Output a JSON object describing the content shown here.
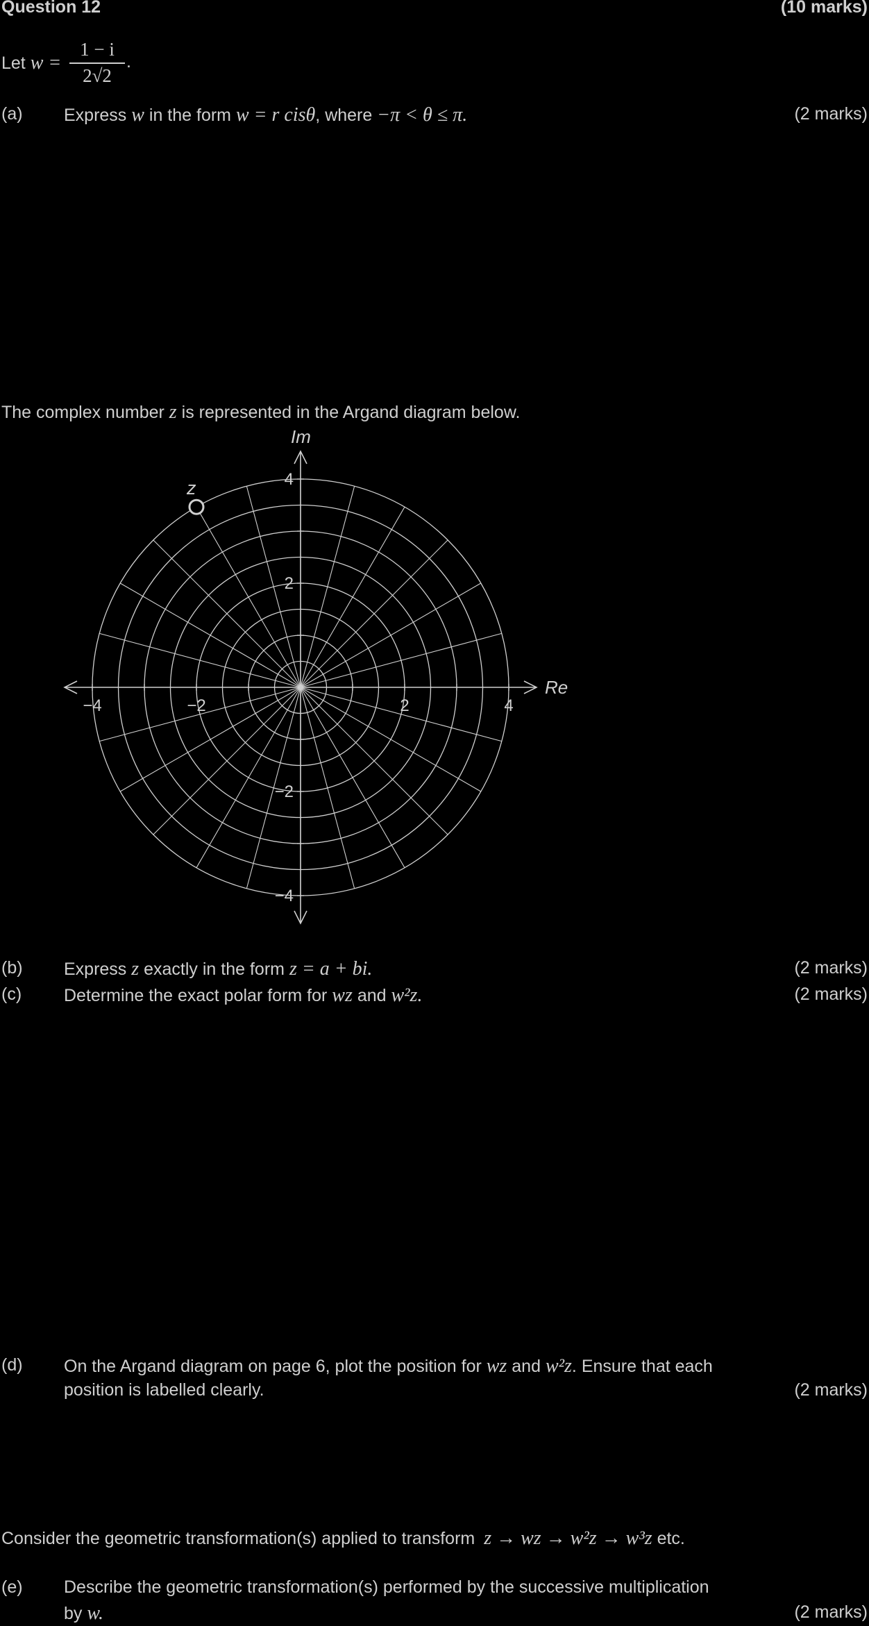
{
  "header": {
    "question": "Question 12",
    "total_marks": "(10 marks)"
  },
  "intro": {
    "let_prefix": "Let",
    "w_var": "w =",
    "num": "1 − i",
    "den": "2√2",
    "end": "."
  },
  "part_a": {
    "label": "(a)",
    "t1": "Express",
    "v1": "w",
    "t2": "in the form",
    "v2": "w = r cisθ",
    "t3": ", where",
    "v3": "−π < θ ≤ π.",
    "marks": "(2 marks)"
  },
  "diagram": {
    "intro_t1": "The complex number",
    "intro_v": "z",
    "intro_t2": "is represented in the Argand diagram below.",
    "im_label": "Im",
    "re_label": "Re",
    "point_label": "z",
    "x_ticks": [
      "−4",
      "−2",
      "2",
      "4"
    ],
    "y_ticks": [
      "4",
      "2",
      "−2",
      "−4"
    ]
  },
  "chart_data": {
    "type": "scatter",
    "title": "",
    "xlabel": "Re",
    "ylabel": "Im",
    "xlim": [
      -4,
      4
    ],
    "ylim": [
      -4,
      4
    ],
    "grid": "polar",
    "radial_circles": [
      0.5,
      1,
      1.5,
      2,
      2.5,
      3,
      3.5,
      4
    ],
    "ray_angle_step_deg": 15,
    "points": [
      {
        "label": "z",
        "modulus": 4,
        "argument_deg": 120
      }
    ]
  },
  "part_b": {
    "label": "(b)",
    "t1": "Express",
    "v1": "z",
    "t2": "exactly in the form",
    "v2": "z = a + bi.",
    "marks": "(2 marks)"
  },
  "part_c": {
    "label": "(c)",
    "t1": "Determine the exact polar form for",
    "v1": "wz",
    "t2": "and",
    "v2": "w²z.",
    "marks": "(2 marks)"
  },
  "part_d": {
    "label": "(d)",
    "t1": "On the Argand diagram on page 6, plot the position for",
    "v1": "wz",
    "t2": "and",
    "v2": "w²z",
    "t3": ". Ensure that each",
    "line2": "position is labelled clearly.",
    "marks": "(2 marks)"
  },
  "transform": {
    "t1": "Consider the geometric transformation(s) applied to transform",
    "v1": "z → wz → w²z → w³z",
    "t2": "etc."
  },
  "part_e": {
    "label": "(e)",
    "line1": "Describe the geometric transformation(s) performed by the successive multiplication",
    "line2_t": "by",
    "line2_v": "w.",
    "marks": "(2 marks)"
  }
}
